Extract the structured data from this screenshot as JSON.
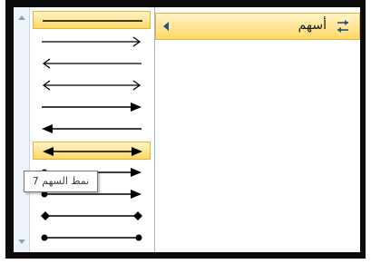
{
  "menu": {
    "arrows_label": "أسهم",
    "arrows_icon": "arrows-icon",
    "submenu_indicator": "submenu-caret-icon"
  },
  "gallery": {
    "scroll_up_icon": "scroll-up-icon",
    "scroll_down_icon": "scroll-down-icon",
    "styles": [
      {
        "name": "line-plain",
        "selected": true
      },
      {
        "name": "arrow-right-open"
      },
      {
        "name": "arrow-left-open"
      },
      {
        "name": "arrow-double-open"
      },
      {
        "name": "arrow-right-filled"
      },
      {
        "name": "arrow-left-filled"
      },
      {
        "name": "arrow-double-filled",
        "hovered": true
      },
      {
        "name": "dot-arrow-right-filled"
      },
      {
        "name": "dot-arrow-right-filled-2"
      },
      {
        "name": "diamond-double"
      },
      {
        "name": "dot-double"
      }
    ]
  },
  "tooltip": {
    "text": "نمط السهم 7"
  },
  "colors": {
    "highlight_top": "#fff3c8",
    "highlight_bottom": "#ffd966",
    "highlight_border": "#e6b143",
    "scroll_bg": "#eef3fa"
  }
}
